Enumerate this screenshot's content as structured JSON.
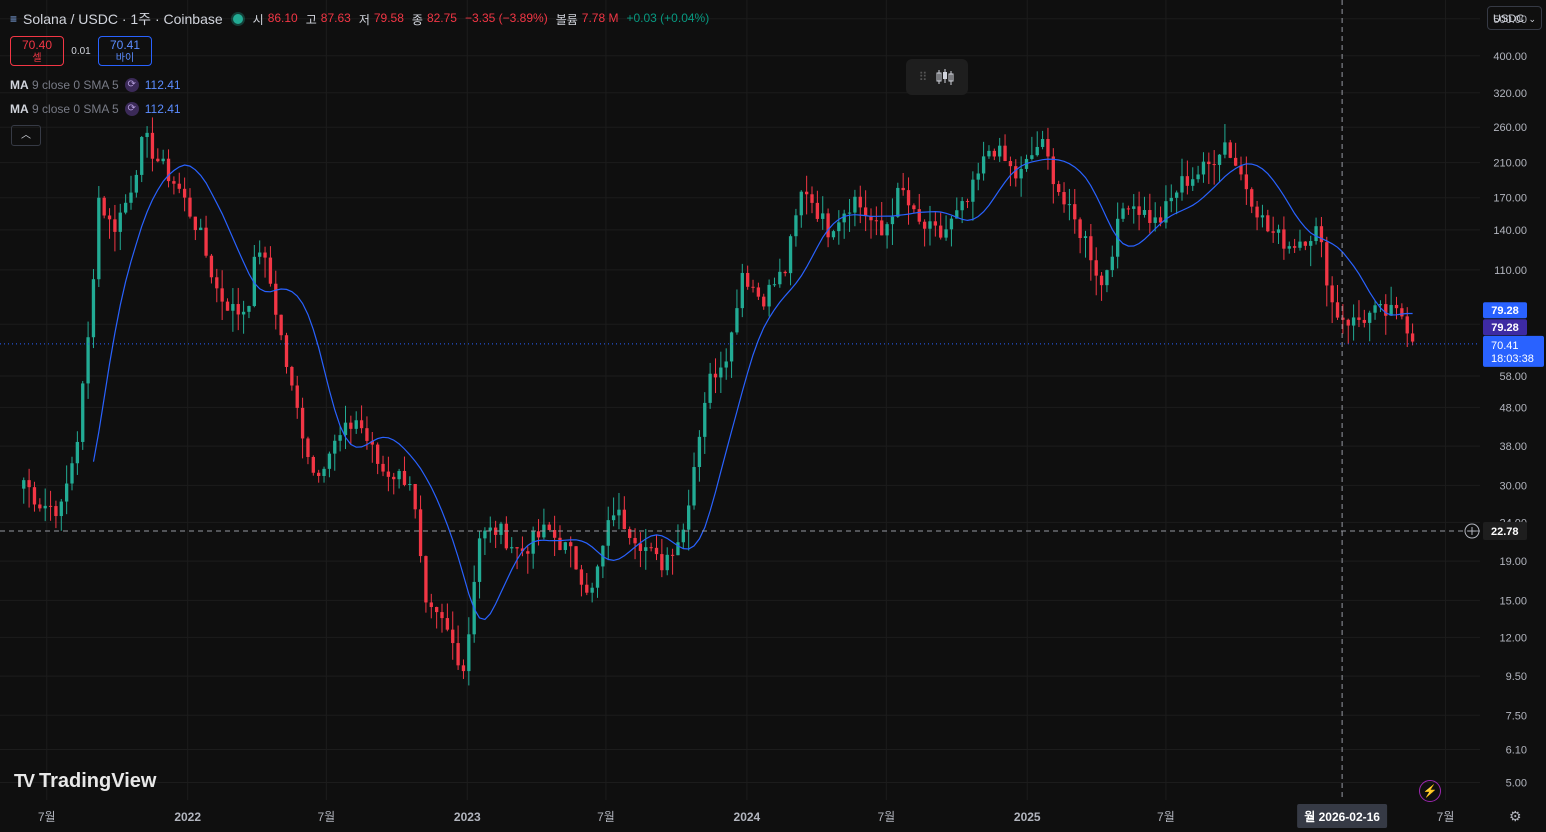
{
  "header": {
    "symbol": "Solana / USDC · 1주 · Coinbase",
    "open_label": "시",
    "open_value": "86.10",
    "high_label": "고",
    "high_value": "87.63",
    "low_label": "저",
    "low_value": "79.58",
    "close_label": "종",
    "close_value": "82.75",
    "change": "−3.35 (−3.89%)",
    "volume_label": "볼륨",
    "volume_value": "7.78 M",
    "volume_change": "+0.03 (+0.04%)"
  },
  "trade": {
    "sell_price": "70.40",
    "sell_label": "셀",
    "spread": "0.01",
    "buy_price": "70.41",
    "buy_label": "바이"
  },
  "indicators": [
    {
      "name": "MA",
      "params": "9 close 0 SMA 5",
      "value": "112.41"
    },
    {
      "name": "MA",
      "params": "9 close 0 SMA 5",
      "value": "112.41"
    }
  ],
  "currency_selector": "USDC",
  "brand": "TradingView",
  "price_axis": {
    "ticks": [
      "500.00",
      "400.00",
      "320.00",
      "260.00",
      "210.00",
      "170.00",
      "140.00",
      "110.00",
      "79.28",
      "58.00",
      "48.00",
      "38.00",
      "30.00",
      "24.00",
      "19.00",
      "15.00",
      "12.00",
      "9.50",
      "7.50",
      "6.10",
      "5.00"
    ],
    "ma_badge_1": "79.28",
    "ma_badge_2": "79.28",
    "last_price": "70.41",
    "countdown": "18:03:38",
    "crosshair_price": "22.78"
  },
  "time_axis": {
    "labels": [
      "7월",
      "2022",
      "7월",
      "2023",
      "7월",
      "2024",
      "7월",
      "2025",
      "7월",
      "7월"
    ],
    "crosshair_label": "월 2026-02-16"
  },
  "colors": {
    "background": "#0f0f0f",
    "up": "#22ab94",
    "down": "#f23645",
    "ma_line": "#2962ff",
    "last_price_badge": "#2962ff"
  },
  "chart_data": {
    "type": "candlestick",
    "scale": "log",
    "interval": "1W",
    "y_range": [
      4.5,
      560
    ],
    "x_range": [
      "2021-05-01",
      "2026-08-15"
    ],
    "anchors": [
      {
        "date": "2021-06-01",
        "price": 31
      },
      {
        "date": "2021-06-20",
        "price": 27
      },
      {
        "date": "2021-07-20",
        "price": 26
      },
      {
        "date": "2021-08-10",
        "price": 40
      },
      {
        "date": "2021-08-25",
        "price": 75
      },
      {
        "date": "2021-09-07",
        "price": 170
      },
      {
        "date": "2021-09-25",
        "price": 140
      },
      {
        "date": "2021-10-15",
        "price": 170
      },
      {
        "date": "2021-11-05",
        "price": 245
      },
      {
        "date": "2021-11-25",
        "price": 210
      },
      {
        "date": "2021-12-20",
        "price": 180
      },
      {
        "date": "2022-01-15",
        "price": 140
      },
      {
        "date": "2022-02-10",
        "price": 95
      },
      {
        "date": "2022-03-05",
        "price": 85
      },
      {
        "date": "2022-03-20",
        "price": 88
      },
      {
        "date": "2022-04-03",
        "price": 130
      },
      {
        "date": "2022-04-20",
        "price": 100
      },
      {
        "date": "2022-05-15",
        "price": 55
      },
      {
        "date": "2022-06-15",
        "price": 32
      },
      {
        "date": "2022-07-10",
        "price": 38
      },
      {
        "date": "2022-08-10",
        "price": 45
      },
      {
        "date": "2022-09-10",
        "price": 33
      },
      {
        "date": "2022-10-20",
        "price": 31
      },
      {
        "date": "2022-11-08",
        "price": 14
      },
      {
        "date": "2022-12-01",
        "price": 13
      },
      {
        "date": "2022-12-29",
        "price": 9.8
      },
      {
        "date": "2023-01-15",
        "price": 22
      },
      {
        "date": "2023-02-10",
        "price": 23
      },
      {
        "date": "2023-03-10",
        "price": 20
      },
      {
        "date": "2023-04-15",
        "price": 23
      },
      {
        "date": "2023-05-15",
        "price": 20
      },
      {
        "date": "2023-06-12",
        "price": 15.5
      },
      {
        "date": "2023-07-10",
        "price": 26
      },
      {
        "date": "2023-08-10",
        "price": 22
      },
      {
        "date": "2023-09-10",
        "price": 18.5
      },
      {
        "date": "2023-10-10",
        "price": 23
      },
      {
        "date": "2023-11-10",
        "price": 55
      },
      {
        "date": "2023-12-10",
        "price": 70
      },
      {
        "date": "2023-12-25",
        "price": 110
      },
      {
        "date": "2024-01-20",
        "price": 92
      },
      {
        "date": "2024-02-20",
        "price": 110
      },
      {
        "date": "2024-03-15",
        "price": 185
      },
      {
        "date": "2024-04-15",
        "price": 140
      },
      {
        "date": "2024-05-20",
        "price": 170
      },
      {
        "date": "2024-06-25",
        "price": 135
      },
      {
        "date": "2024-07-20",
        "price": 180
      },
      {
        "date": "2024-08-10",
        "price": 145
      },
      {
        "date": "2024-09-10",
        "price": 135
      },
      {
        "date": "2024-10-15",
        "price": 165
      },
      {
        "date": "2024-11-15",
        "price": 235
      },
      {
        "date": "2024-12-20",
        "price": 190
      },
      {
        "date": "2025-01-18",
        "price": 240
      },
      {
        "date": "2025-02-20",
        "price": 160
      },
      {
        "date": "2025-03-20",
        "price": 130
      },
      {
        "date": "2025-04-08",
        "price": 100
      },
      {
        "date": "2025-05-10",
        "price": 170
      },
      {
        "date": "2025-06-20",
        "price": 145
      },
      {
        "date": "2025-07-20",
        "price": 185
      },
      {
        "date": "2025-08-25",
        "price": 205
      },
      {
        "date": "2025-09-15",
        "price": 240
      },
      {
        "date": "2025-10-10",
        "price": 190
      },
      {
        "date": "2025-11-10",
        "price": 140
      },
      {
        "date": "2025-12-10",
        "price": 128
      },
      {
        "date": "2026-01-15",
        "price": 140
      },
      {
        "date": "2026-02-05",
        "price": 86
      },
      {
        "date": "2026-03-01",
        "price": 80
      },
      {
        "date": "2026-04-01",
        "price": 85
      },
      {
        "date": "2026-05-05",
        "price": 84
      },
      {
        "date": "2026-05-25",
        "price": 70
      }
    ]
  }
}
